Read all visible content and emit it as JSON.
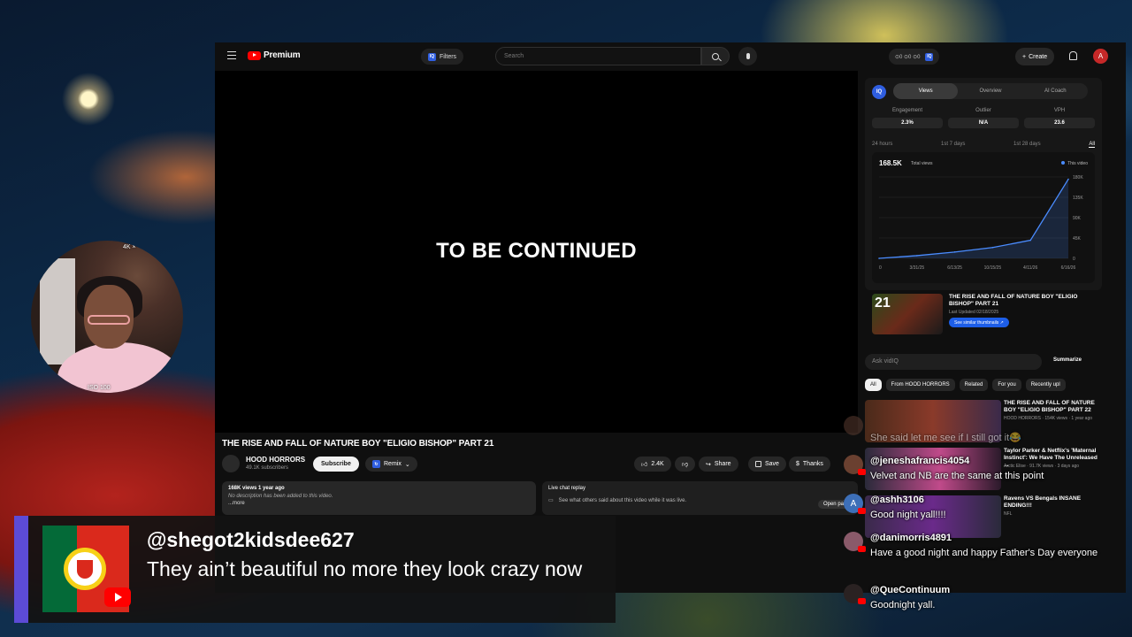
{
  "youtube": {
    "logo_text": "Premium",
    "filters_label": "Filters",
    "search_placeholder": "Search",
    "stats_pill": "⊙0 ⊙0 ⊙0",
    "create_label": "Create",
    "avatar_letter": "A",
    "player_text": "TO BE CONTINUED",
    "video_title": "THE RISE AND FALL OF NATURE BOY \"ELIGIO BISHOP\" PART 21",
    "channel_name": "HOOD HORRORS",
    "channel_subs": "49.1K subscribers",
    "subscribe_label": "Subscribe",
    "remix_label": "Remix",
    "likes": "2.4K",
    "share_label": "Share",
    "save_label": "Save",
    "thanks_label": "Thanks",
    "description": {
      "meta": "168K views  1 year ago",
      "text": "No description has been added to this video.",
      "more": "...more"
    },
    "live_chat": {
      "title": "Live chat replay",
      "subtitle": "See what others said about this video while it was live.",
      "open_label": "Open panel"
    }
  },
  "vidiq": {
    "logo": "IQ",
    "tabs": [
      "Views",
      "Overview",
      "AI Coach"
    ],
    "active_tab": "Views",
    "metrics": [
      {
        "label": "Engagement",
        "value": "2.3%"
      },
      {
        "label": "Outlier",
        "value": "N/A"
      },
      {
        "label": "VPH",
        "value": "23.6"
      }
    ],
    "ranges": [
      "24 hours",
      "1st 7 days",
      "1st 28 days",
      "All"
    ],
    "active_range": "All",
    "total_views": "168.5K",
    "total_views_label": "Total views",
    "legend": "This video",
    "thumbnail_title": "THE RISE AND FALL OF NATURE BOY \"ELIGIO BISHOP\" PART 21",
    "thumbnail_date": "Last Updated 02/18/2025",
    "thumbnail_number": "21",
    "similar_label": "See similar thumbnails ↗"
  },
  "chart_data": {
    "type": "line",
    "series": [
      {
        "name": "This video",
        "x": [
          "0",
          "3/31/25",
          "6/13/25",
          "10/15/25",
          "4/11/26",
          "6/16/26"
        ],
        "values": [
          0,
          6000,
          14000,
          24000,
          40000,
          175000
        ]
      }
    ],
    "xlabel": "",
    "ylabel": "",
    "yticks": [
      "0",
      "45K",
      "90K",
      "135K",
      "180K"
    ],
    "xticks": [
      "0",
      "3/31/25",
      "6/13/25",
      "10/15/25",
      "4/11/26",
      "6/16/26"
    ],
    "ylim": [
      0,
      180000
    ]
  },
  "related": {
    "ask_placeholder": "Ask vidIQ",
    "summarize_label": "Summarize",
    "chips": [
      "All",
      "From HOOD HORRORS",
      "Related",
      "For you",
      "Recently upl"
    ],
    "active_chip": "All",
    "items": [
      {
        "title": "THE RISE AND FALL OF NATURE BOY \"ELIGIO BISHOP\" PART 22",
        "meta": "HOOD HORRORS · 154K views · 1 year ago"
      },
      {
        "title": "Taylor Parker & Netflix's 'Maternal Instinct': We Have The Unreleased ...",
        "meta": "Arctic Elise · 91.7K views · 3 days ago"
      },
      {
        "title": "Ravens VS Bengals INSANE ENDING!!!",
        "meta": "NFL"
      }
    ]
  },
  "chat": [
    {
      "name": "",
      "text": "She said let me see if I still got it😂",
      "faded": true
    },
    {
      "name": "@jeneshafrancis4054",
      "text": "Velvet and NB are the same at this point"
    },
    {
      "name": "@ashh3106",
      "text": "Good night yall!!!!",
      "avatar_letter": "A"
    },
    {
      "name": "@danimorris4891",
      "text": "Have a good night and happy Father's Day everyone"
    },
    {
      "name": "@QueContinuum",
      "text": "Goodnight yall."
    }
  ],
  "webcam": {
    "top_label": "4K ×",
    "iso_label": "ISO 100"
  },
  "superchat": {
    "name": "@shegot2kidsdee627",
    "message": "They ain’t beautiful no more they look crazy now"
  }
}
